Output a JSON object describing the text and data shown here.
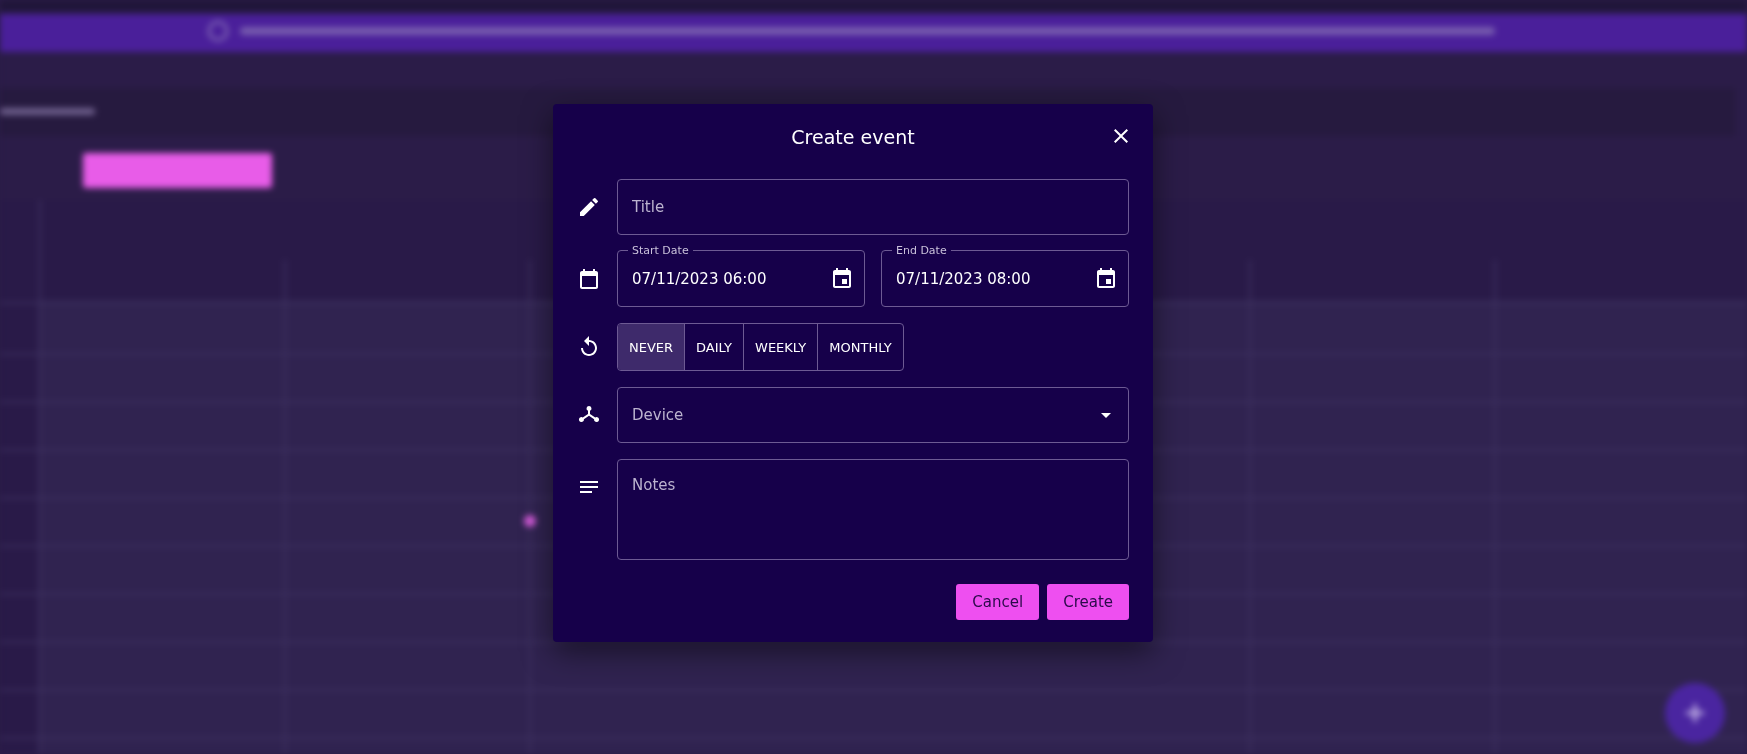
{
  "dialog": {
    "title": "Create event",
    "title_field": {
      "placeholder": "Title"
    },
    "start_date": {
      "label": "Start Date",
      "value": "07/11/2023 06:00"
    },
    "end_date": {
      "label": "End Date",
      "value": "07/11/2023 08:00"
    },
    "repeat_options": [
      {
        "label": "NEVER",
        "selected": true
      },
      {
        "label": "DAILY",
        "selected": false
      },
      {
        "label": "WEEKLY",
        "selected": false
      },
      {
        "label": "MONTHLY",
        "selected": false
      }
    ],
    "device_field": {
      "placeholder": "Device"
    },
    "notes_field": {
      "placeholder": "Notes"
    },
    "buttons": [
      {
        "label": "Cancel"
      },
      {
        "label": "Create"
      }
    ]
  }
}
